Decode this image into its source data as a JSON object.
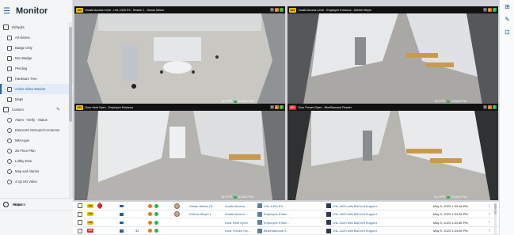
{
  "app": {
    "title": "Monitor",
    "menu_icon": "hamburger-arrow-icon"
  },
  "sidebar": {
    "groups": [
      {
        "label": "Defaults",
        "icon": "folder-icon",
        "items": [
          {
            "label": "All Alarms",
            "icon": "alarm-list-icon"
          },
          {
            "label": "Badge Only",
            "icon": "badge-icon"
          },
          {
            "label": "Non-Badge",
            "icon": "person-off-icon"
          },
          {
            "label": "Pending",
            "icon": "diamond-icon"
          },
          {
            "label": "Hardware Tree",
            "icon": "tree-icon"
          },
          {
            "label": "Active Video Monitor",
            "icon": "video-icon",
            "active": true
          },
          {
            "label": "Maps",
            "icon": "map-icon"
          }
        ]
      },
      {
        "label": "Custom",
        "icon": "custom-folder-icon",
        "edit_icon": "pencil-icon",
        "items": [
          {
            "label": "Alarm - Verify - Status",
            "icon": "circle-icon"
          },
          {
            "label": "Elements OnGuard Connector",
            "icon": "circle-icon"
          },
          {
            "label": "MM equin",
            "icon": "circle-icon"
          },
          {
            "label": "2D Floor Plan",
            "icon": "circle-icon"
          },
          {
            "label": "Lobby Door",
            "icon": "circle-icon"
          },
          {
            "label": "Map and Alarms",
            "icon": "circle-icon"
          },
          {
            "label": "4 Up HD Video",
            "icon": "circle-icon"
          }
        ]
      }
    ],
    "bottom": [
      {
        "label": "Account",
        "icon": "account-icon"
      },
      {
        "label": "About",
        "icon": "info-icon"
      },
      {
        "label": "Help",
        "icon": "help-icon",
        "extra_icon": "external-link-icon"
      }
    ]
  },
  "tiles": [
    {
      "tag": "123",
      "tag_color": "#f2c200",
      "title": "Invalid Access Level - LNL-1320 R3 - Reader 1 - Susan Weber",
      "fps": "14.9 FPS",
      "time": "01:26:27 PM"
    },
    {
      "tag": "123",
      "tag_color": "#f2c200",
      "title": "Invalid Access Level - Employee Entrance - Debbie Meyer",
      "fps": "29.9 FPS",
      "time": "01:26:27 PM"
    },
    {
      "tag": "123",
      "tag_color": "#f2c200",
      "title": "Door Held Open - Employee Entrance",
      "fps": "29.9 FPS",
      "time": "01:26:27 PM"
    },
    {
      "tag": "300",
      "tag_color": "#d62b2b",
      "title": "Door Forced Open - BlueDiamond Reader",
      "fps": "61.9 FPS",
      "time": "01:26:27 PM"
    }
  ],
  "tile_icons": [
    "layout-icon",
    "flame-icon",
    "check-icon"
  ],
  "alarms": [
    {
      "priority": "123",
      "color": "#f2c200",
      "person": "Susan Weber (S...",
      "event": "Invalid Access ...",
      "device": "LNL-1320 R3 -...",
      "panel": "LNL-4420 with BACnet Support",
      "time": "May 9, 2023 1:39:18 PM",
      "has_avatar": true,
      "badge": true
    },
    {
      "priority": "123",
      "color": "#f2c200",
      "person": "Debbie Meyer (...",
      "event": "Invalid Access ...",
      "device": "Employee Entra...",
      "panel": "LNL-4420 with BACnet Support",
      "time": "May 9, 2023 1:34:45 PM",
      "has_avatar": true,
      "badge": false
    },
    {
      "priority": "123",
      "color": "#f2c200",
      "person": "",
      "event": "Door Held Open",
      "device": "Employee Entra...",
      "panel": "LNL-4420 with BACnet Support",
      "time": "May 9, 2023 1:34:38 PM",
      "has_avatar": false,
      "badge": false
    },
    {
      "priority": "300",
      "color": "#d62b2b",
      "person": "",
      "count": "33",
      "event": "Door Forced Op...",
      "device": "BlueDiamond R...",
      "panel": "LNL-4420 with BACnet Support",
      "time": "May 9, 2023 1:34:08 PM",
      "has_avatar": false,
      "badge": false
    }
  ],
  "right_tools": [
    "grid-layout-icon",
    "draw-icon",
    "add-screen-icon"
  ]
}
